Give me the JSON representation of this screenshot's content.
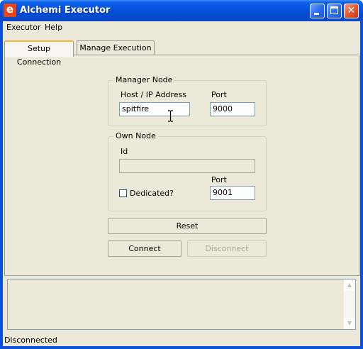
{
  "window": {
    "title": "Alchemi Executor",
    "app_icon_glyph": "e",
    "accent": "#0a5ee8"
  },
  "menu": {
    "items": [
      "Executor",
      "Help"
    ]
  },
  "tabs": [
    {
      "label": "Setup Connection",
      "active": true
    },
    {
      "label": "Manage Execution",
      "active": false
    }
  ],
  "manager_node": {
    "legend": "Manager Node",
    "host_label": "Host / IP Address",
    "host_value": "spitfire",
    "port_label": "Port",
    "port_value": "9000"
  },
  "own_node": {
    "legend": "Own Node",
    "id_label": "Id",
    "id_value": "",
    "port_label": "Port",
    "port_value": "9001",
    "dedicated_label": "Dedicated?",
    "dedicated_checked": false
  },
  "buttons": {
    "reset": "Reset",
    "connect": "Connect",
    "disconnect": "Disconnect"
  },
  "status": {
    "text": "Disconnected"
  }
}
